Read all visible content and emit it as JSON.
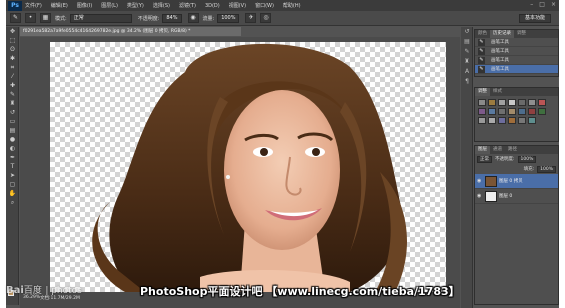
{
  "menubar": {
    "logo": "Ps",
    "items": [
      "文件(F)",
      "编辑(E)",
      "图像(I)",
      "图层(L)",
      "类型(Y)",
      "选择(S)",
      "滤镜(T)",
      "3D(D)",
      "视图(V)",
      "窗口(W)",
      "帮助(H)"
    ],
    "window_controls": [
      "–",
      "□",
      "×"
    ]
  },
  "options_bar": {
    "mode_label": "模式:",
    "mode_value": "正常",
    "opacity_label": "不透明度:",
    "opacity_value": "84%",
    "flow_label": "流量:",
    "flow_value": "100%",
    "workspace": "基本功能"
  },
  "document": {
    "tab_title": "f0291ea582a7a9fe0554c4164269782e.jpg @ 34.2% (图层 0 拷贝, RGB/8) *",
    "zoom": "36.29%",
    "doc_info": "文档:11.7M/29.2M"
  },
  "history_panel": {
    "tabs": [
      "颜色",
      "历史记录",
      "调整"
    ],
    "items": [
      {
        "label": "画笔工具",
        "selected": false
      },
      {
        "label": "画笔工具",
        "selected": false
      },
      {
        "label": "画笔工具",
        "selected": false
      },
      {
        "label": "画笔工具",
        "selected": true
      }
    ]
  },
  "adjust_panel": {
    "tabs": [
      "调整",
      "样式"
    ],
    "swatch_colors": [
      "#8a8a8a",
      "#9b7b3f",
      "#a0a0a0",
      "#c8c8c8",
      "#6a6a6a",
      "#8f8f8f",
      "#b55",
      "#7d5a8a",
      "#5a7aa0",
      "#6f6f6f",
      "#a38b6a",
      "#4d6d8d",
      "#8f4040",
      "#3f6f3f",
      "#999",
      "#aaa",
      "#6d6d9d",
      "#a06d3a",
      "#777",
      "#5e8e8e"
    ]
  },
  "layers_panel": {
    "tabs": [
      "图层",
      "通道",
      "路径"
    ],
    "blend_mode": "正常",
    "opacity_label": "不透明度:",
    "opacity_value": "100%",
    "fill_label": "填充:",
    "fill_value": "100%",
    "layers": [
      {
        "name": "图层 0 拷贝",
        "selected": true
      },
      {
        "name": "图层 0",
        "selected": false
      }
    ]
  },
  "overlay": {
    "watermark_brand": "Bai",
    "watermark_rest": "百度",
    "watermark_site": "| photos",
    "caption": "PhotoShop平面设计吧 【www.linecg.com/tieba/1783】"
  }
}
